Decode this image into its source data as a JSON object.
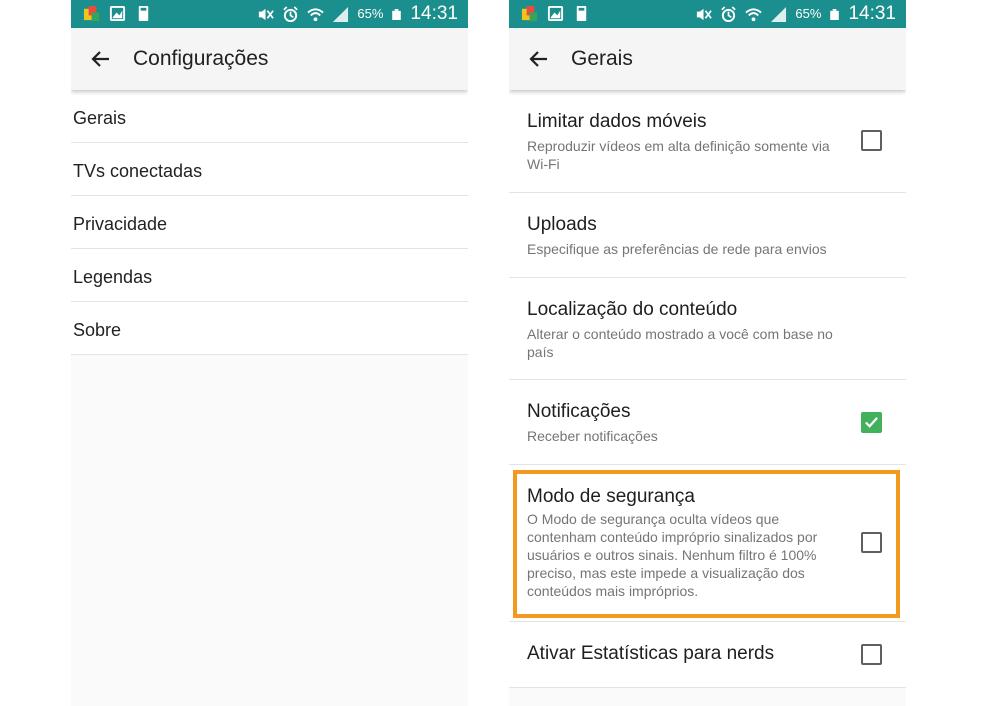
{
  "status_bar": {
    "battery_percent": "65%",
    "time": "14:31",
    "color": "#1b8f8d"
  },
  "left_screen": {
    "title": "Configurações",
    "items": [
      {
        "label": "Gerais"
      },
      {
        "label": "TVs conectadas"
      },
      {
        "label": "Privacidade"
      },
      {
        "label": "Legendas"
      },
      {
        "label": "Sobre"
      }
    ]
  },
  "right_screen": {
    "title": "Gerais",
    "settings": [
      {
        "title": "Limitar dados móveis",
        "summary": "Reproduzir vídeos em alta definição somente via Wi-Fi",
        "checked": false
      },
      {
        "title": "Uploads",
        "summary": "Especifique as preferências de rede para envios"
      },
      {
        "title": "Localização do conteúdo",
        "summary": "Alterar o conteúdo mostrado a você com base no país"
      },
      {
        "title": "Notificações",
        "summary": "Receber notificações",
        "checked": true
      },
      {
        "title": "Modo de segurança",
        "summary": "O Modo de segurança oculta vídeos que contenham conteúdo impróprio sinalizados por usuários e outros sinais. Nenhum filtro é 100% preciso, mas este impede a visualização dos conteúdos mais impróprios.",
        "checked": false,
        "highlighted": true
      },
      {
        "title": "Ativar Estatísticas para nerds",
        "summary": "",
        "checked": false
      }
    ]
  },
  "colors": {
    "accent_highlight": "#f29a1f",
    "checkbox_checked": "#43b05c"
  },
  "icons": [
    "app-notification-icon",
    "image-icon",
    "sd-card-icon",
    "mute-icon",
    "alarm-icon",
    "wifi-icon",
    "signal-icon",
    "battery-icon",
    "back-arrow-icon",
    "checkmark-icon"
  ]
}
